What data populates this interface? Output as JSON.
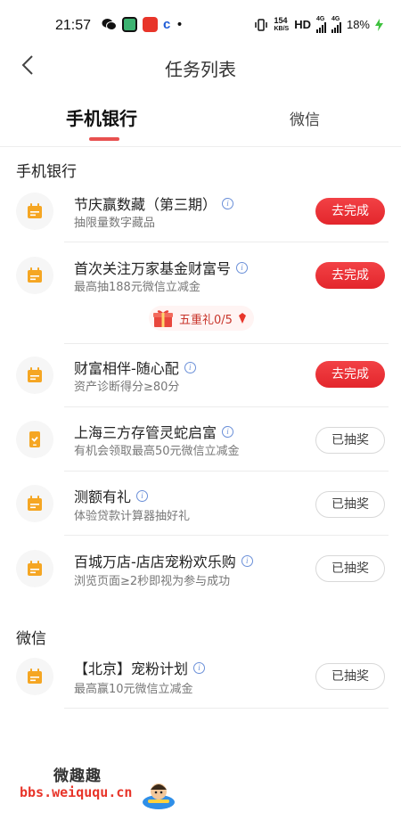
{
  "status_bar": {
    "time": "21:57",
    "speed_value": "154",
    "speed_unit": "KB/S",
    "hd": "HD",
    "sig1_label": "4G",
    "sig2_label": "4G",
    "battery": "18%"
  },
  "header": {
    "back_icon": "chevron-left-icon",
    "title": "任务列表"
  },
  "tabs": [
    {
      "label": "手机银行",
      "active": true
    },
    {
      "label": "微信",
      "active": false
    }
  ],
  "sections": {
    "bank_title": "手机银行",
    "wechat_title": "微信"
  },
  "tasks": [
    {
      "name": "节庆赢数藏（第三期）",
      "sub": "抽限量数字藏品",
      "button": "去完成",
      "button_style": "primary",
      "icon": "calendar-icon"
    },
    {
      "name": "首次关注万家基金财富号",
      "sub": "最高抽188元微信立减金",
      "button": "去完成",
      "button_style": "primary",
      "icon": "calendar-icon"
    },
    {
      "name": "财富相伴-随心配",
      "sub": "资产诊断得分≥80分",
      "button": "去完成",
      "button_style": "primary",
      "icon": "calendar-icon"
    },
    {
      "name": "上海三方存管灵蛇启富",
      "sub": "有机会领取最高50元微信立减金",
      "button": "已抽奖",
      "button_style": "outline",
      "icon": "phone-icon"
    },
    {
      "name": "测额有礼",
      "sub": "体验贷款计算器抽好礼",
      "button": "已抽奖",
      "button_style": "outline",
      "icon": "calendar-icon"
    },
    {
      "name": "百城万店-店店宠粉欢乐购",
      "sub": "浏览页面≥2秒即视为参与成功",
      "button": "已抽奖",
      "button_style": "outline",
      "icon": "calendar-icon"
    },
    {
      "name": "【北京】宠粉计划",
      "sub": "最高赢10元微信立减金",
      "button": "已抽奖",
      "button_style": "outline",
      "icon": "calendar-icon"
    }
  ],
  "gift_badge": {
    "label": "五重礼0/5",
    "icon": "gift-icon"
  },
  "watermark": {
    "top": "微趣趣",
    "bottom": "bbs.weiququ.cn"
  },
  "colors": {
    "accent": "#e8504f",
    "button_red": "#e3262c",
    "icon_orange": "#f5a623"
  }
}
